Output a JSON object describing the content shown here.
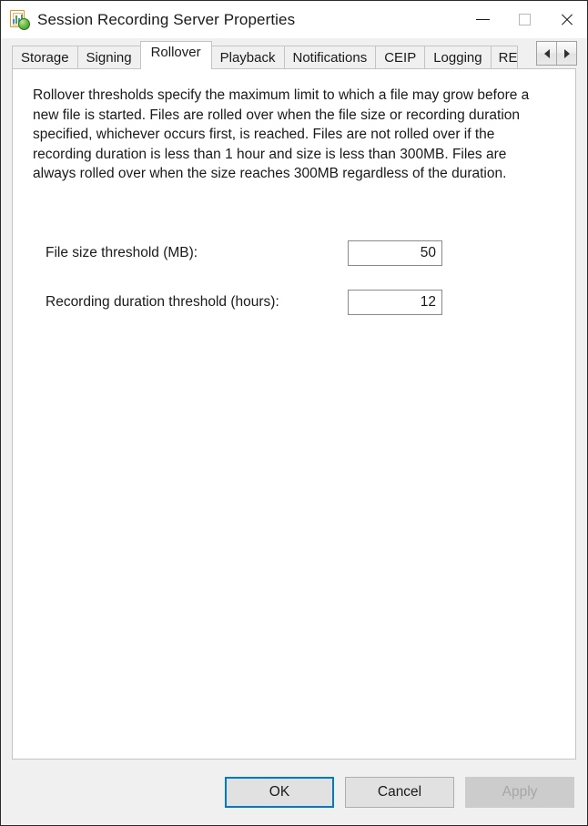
{
  "window": {
    "title": "Session Recording Server Properties",
    "icon": "session-recording-icon",
    "controls": {
      "minimize": "—",
      "maximize": "□",
      "close": "✕"
    }
  },
  "tabs": {
    "items": [
      {
        "label": "Storage",
        "active": false
      },
      {
        "label": "Signing",
        "active": false
      },
      {
        "label": "Rollover",
        "active": true
      },
      {
        "label": "Playback",
        "active": false
      },
      {
        "label": "Notifications",
        "active": false
      },
      {
        "label": "CEIP",
        "active": false
      },
      {
        "label": "Logging",
        "active": false
      },
      {
        "label": "RE",
        "active": false
      }
    ],
    "scroll_left": "◄",
    "scroll_right": "►"
  },
  "content": {
    "description": "Rollover thresholds specify the maximum limit to which a file may grow before a new file is started. Files are rolled over when the file size or recording duration specified, whichever occurs first, is reached. Files are not rolled over if the recording duration is less than 1 hour and size is less than 300MB. Files are always rolled over when the size reaches 300MB regardless of the duration.",
    "fields": [
      {
        "label": "File size threshold (MB):",
        "value": "50"
      },
      {
        "label": "Recording duration threshold (hours):",
        "value": "12"
      }
    ]
  },
  "footer": {
    "ok": "OK",
    "cancel": "Cancel",
    "apply": "Apply"
  },
  "colors": {
    "accent": "#0078d7",
    "dialog_bg": "#f0f0f0",
    "panel_bg": "#ffffff",
    "text": "#1a1a1a"
  }
}
